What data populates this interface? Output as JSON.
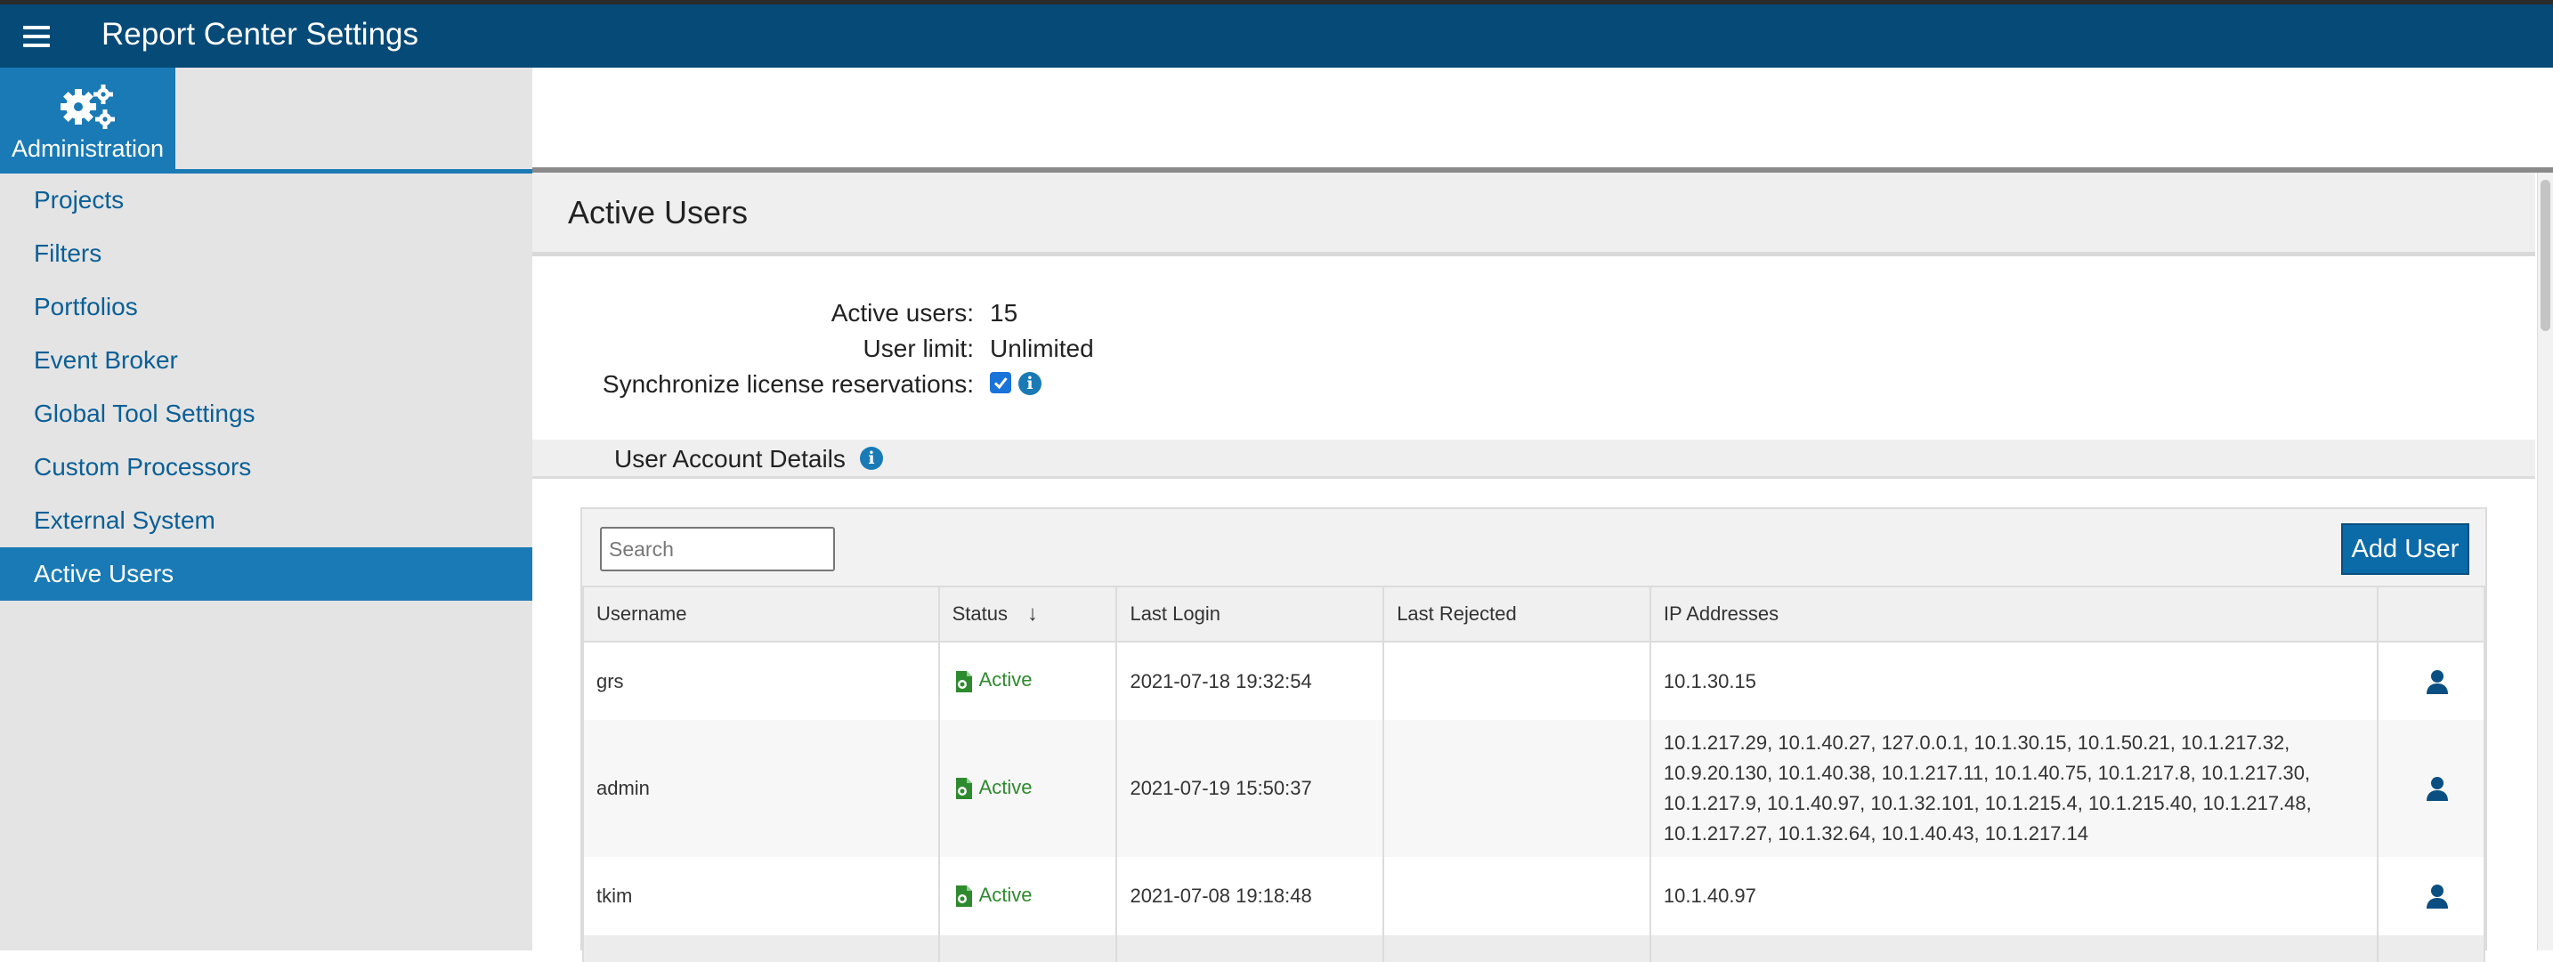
{
  "app": {
    "title": "Report Center Settings"
  },
  "admin_tab": {
    "label": "Administration",
    "icon": "gears-icon"
  },
  "sidebar": {
    "items": [
      {
        "label": "Projects",
        "active": false
      },
      {
        "label": "Filters",
        "active": false
      },
      {
        "label": "Portfolios",
        "active": false
      },
      {
        "label": "Event Broker",
        "active": false
      },
      {
        "label": "Global Tool Settings",
        "active": false
      },
      {
        "label": "Custom Processors",
        "active": false
      },
      {
        "label": "External System",
        "active": false
      },
      {
        "label": "Active Users",
        "active": true
      }
    ]
  },
  "page": {
    "title": "Active Users"
  },
  "summary": {
    "active_users_label": "Active users:",
    "active_users_value": "15",
    "user_limit_label": "User limit:",
    "user_limit_value": "Unlimited",
    "sync_label": "Synchronize license reservations:",
    "sync_checked": true
  },
  "section": {
    "title": "User Account Details"
  },
  "search": {
    "placeholder": "Search",
    "value": ""
  },
  "add_user_label": "Add User",
  "table": {
    "columns": [
      "Username",
      "Status",
      "Last Login",
      "Last Rejected",
      "IP Addresses"
    ],
    "sort_column": "Status",
    "rows": [
      {
        "username": "grs",
        "status": "Active",
        "last_login": "2021-07-18 19:32:54",
        "last_rejected": "",
        "ip_addresses": "10.1.30.15"
      },
      {
        "username": "admin",
        "status": "Active",
        "last_login": "2021-07-19 15:50:37",
        "last_rejected": "",
        "ip_addresses": "10.1.217.29, 10.1.40.27, 127.0.0.1, 10.1.30.15, 10.1.50.21, 10.1.217.32, 10.9.20.130, 10.1.40.38, 10.1.217.11, 10.1.40.75, 10.1.217.8, 10.1.217.30, 10.1.217.9, 10.1.40.97, 10.1.32.101, 10.1.215.4, 10.1.215.40, 10.1.217.48, 10.1.217.27, 10.1.32.64, 10.1.40.43, 10.1.217.14"
      },
      {
        "username": "tkim",
        "status": "Active",
        "last_login": "2021-07-08 19:18:48",
        "last_rejected": "",
        "ip_addresses": "10.1.40.97"
      }
    ]
  },
  "colors": {
    "header": "#064a78",
    "accent": "#1a7ab5",
    "nav_text": "#0b5f96",
    "status_active": "#2e8a2e"
  }
}
